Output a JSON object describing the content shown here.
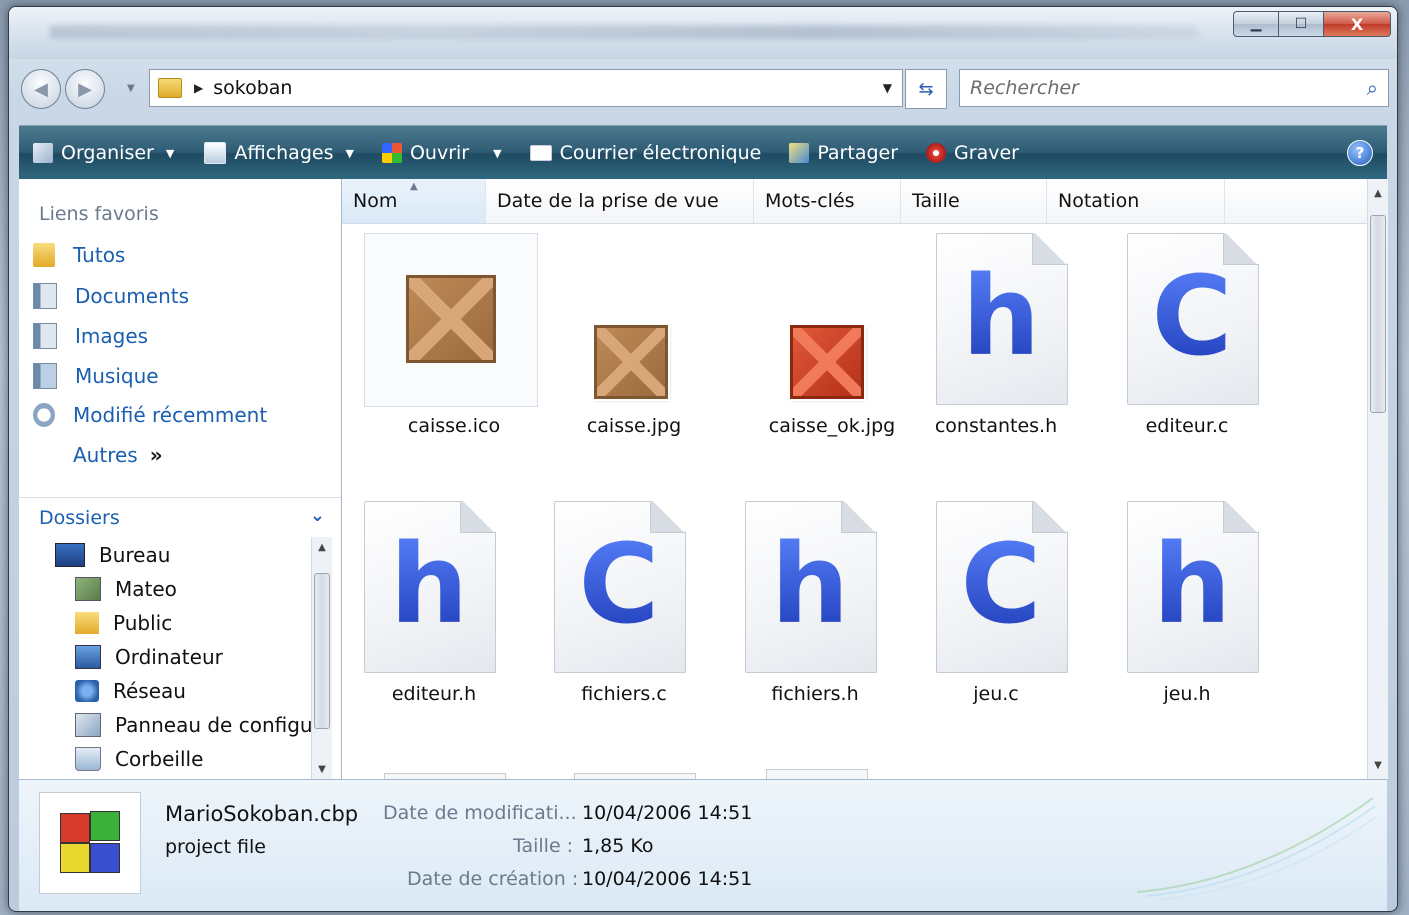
{
  "window": {
    "controls": {
      "minimize": "▁",
      "maximize": "☐",
      "close": "X"
    }
  },
  "nav": {
    "back_icon": "arrow-left-icon",
    "forward_icon": "arrow-right-icon",
    "breadcrumb": "sokoban",
    "search_placeholder": "Rechercher"
  },
  "toolbar": {
    "items": [
      {
        "label": "Organiser",
        "icon": "organize-icon"
      },
      {
        "label": "Affichages",
        "icon": "views-icon"
      },
      {
        "label": "Ouvrir",
        "icon": "open-icon"
      },
      {
        "label": "Courrier électronique",
        "icon": "email-icon"
      },
      {
        "label": "Partager",
        "icon": "share-icon"
      },
      {
        "label": "Graver",
        "icon": "burn-icon"
      }
    ],
    "help_label": "?",
    "bg_color": "#2e5c74"
  },
  "sidebar": {
    "favorites_header": "Liens favoris",
    "favorites": [
      {
        "label": "Tutos",
        "icon": "folder-icon"
      },
      {
        "label": "Documents",
        "icon": "documents-icon"
      },
      {
        "label": "Images",
        "icon": "pictures-icon"
      },
      {
        "label": "Musique",
        "icon": "music-icon"
      },
      {
        "label": "Modifié récemment",
        "icon": "recent-icon"
      },
      {
        "label": "Autres",
        "more": "»"
      }
    ],
    "folders_header": "Dossiers",
    "tree": [
      {
        "label": "Bureau",
        "icon": "desktop-icon"
      },
      {
        "label": "Mateo",
        "icon": "user-folder-icon"
      },
      {
        "label": "Public",
        "icon": "folder-icon"
      },
      {
        "label": "Ordinateur",
        "icon": "computer-icon"
      },
      {
        "label": "Réseau",
        "icon": "network-icon"
      },
      {
        "label": "Panneau de configu",
        "icon": "control-panel-icon"
      },
      {
        "label": "Corbeille",
        "icon": "recycle-bin-icon"
      }
    ]
  },
  "columns": [
    "Nom",
    "Date de la prise de vue",
    "Mots-clés",
    "Taille",
    "Notation"
  ],
  "files": [
    {
      "name": "caisse.ico",
      "kind": "crate"
    },
    {
      "name": "caisse.jpg",
      "kind": "crate"
    },
    {
      "name": "caisse_ok.jpg",
      "kind": "crate-red"
    },
    {
      "name": "constantes.h",
      "kind": "h"
    },
    {
      "name": "editeur.c",
      "kind": "c"
    },
    {
      "name": "editeur.h",
      "kind": "h"
    },
    {
      "name": "fichiers.c",
      "kind": "c"
    },
    {
      "name": "fichiers.h",
      "kind": "h"
    },
    {
      "name": "jeu.c",
      "kind": "c"
    },
    {
      "name": "jeu.h",
      "kind": "h"
    }
  ],
  "details": {
    "filename": "MarioSokoban.cbp",
    "filetype": "project file",
    "modified_label": "Date de modificati...",
    "modified_value": "10/04/2006 14:51",
    "size_label": "Taille :",
    "size_value": "1,85 Ko",
    "created_label": "Date de création :",
    "created_value": "10/04/2006 14:51"
  }
}
